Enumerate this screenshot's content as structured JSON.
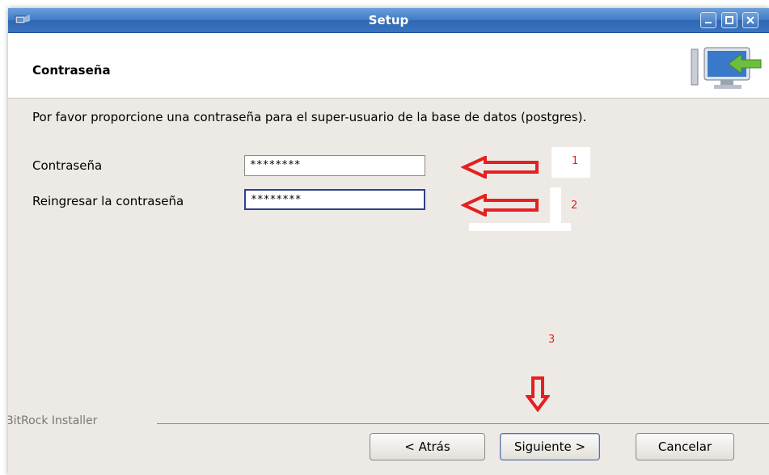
{
  "window": {
    "title": "Setup",
    "controls": [
      "minimize",
      "maximize",
      "close"
    ]
  },
  "header": {
    "page_title": "Contraseña",
    "logo_icon": "computer-install-icon"
  },
  "content": {
    "description": "Por favor proporcione una contraseña para el super-usuario de la base de datos (postgres).",
    "fields": [
      {
        "label": "Contraseña",
        "value": "********"
      },
      {
        "label": "Reingresar la contraseña",
        "value": "********"
      }
    ]
  },
  "annotations": {
    "arrow_color": "#e52020",
    "labels": [
      "1",
      "2",
      "3"
    ]
  },
  "footer": {
    "group_label": "BitRock Installer",
    "buttons": {
      "back": "< Atrás",
      "next": "Siguiente >",
      "cancel": "Cancelar"
    }
  },
  "colors": {
    "titlebar": "#3f7bc7",
    "background": "#edeae5",
    "focus_border": "#2c3f8c"
  }
}
